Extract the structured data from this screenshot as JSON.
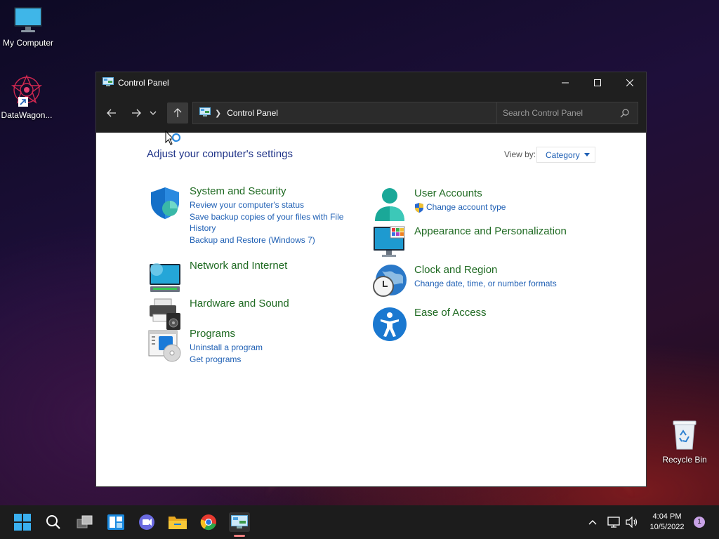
{
  "desktop": {
    "icons": [
      {
        "label": "My Computer"
      },
      {
        "label": "DataWagon..."
      },
      {
        "label": "Recycle Bin"
      }
    ]
  },
  "window": {
    "title": "Control Panel",
    "address": {
      "crumb": "Control Panel"
    },
    "search": {
      "placeholder": "Search Control Panel"
    }
  },
  "content": {
    "heading": "Adjust your computer's settings",
    "view_by_label": "View by:",
    "view_by_value": "Category",
    "categories": [
      {
        "title": "System and Security",
        "links": [
          "Review your computer's status",
          "Save backup copies of your files with File History",
          "Backup and Restore (Windows 7)"
        ],
        "icon": "shield-icon"
      },
      {
        "title": "Network and Internet",
        "links": [],
        "icon": "network-icon"
      },
      {
        "title": "Hardware and Sound",
        "links": [],
        "icon": "printer-icon"
      },
      {
        "title": "Programs",
        "links": [
          "Uninstall a program",
          "Get programs"
        ],
        "icon": "programs-icon"
      },
      {
        "title": "User Accounts",
        "links": [
          "Change account type"
        ],
        "icon": "user-icon"
      },
      {
        "title": "Appearance and Personalization",
        "links": [],
        "icon": "monitor-icon"
      },
      {
        "title": "Clock and Region",
        "links": [
          "Change date, time, or number formats"
        ],
        "icon": "clock-globe-icon"
      },
      {
        "title": "Ease of Access",
        "links": [],
        "icon": "accessibility-icon"
      }
    ]
  },
  "taskbar": {
    "time": "4:04 PM",
    "date": "10/5/2022",
    "notification_count": "1"
  },
  "colors": {
    "category_title": "#1f6a22",
    "link": "#1e5fb4",
    "heading": "#1e3287",
    "titlebar": "#1f1f1f",
    "taskbar": "#1c1c1c"
  }
}
